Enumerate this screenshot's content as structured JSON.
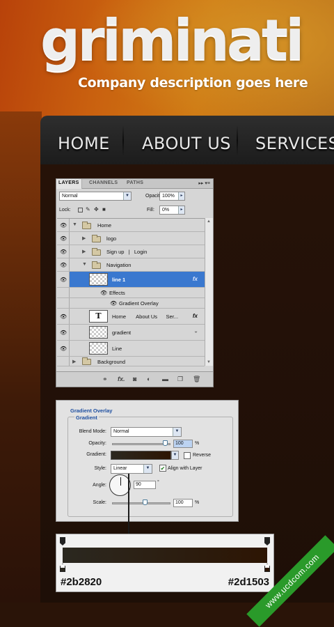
{
  "header": {
    "logo": "griminati",
    "tagline": "Company description goes here"
  },
  "nav": {
    "items": [
      "HOME",
      "ABOUT US",
      "SERVICES"
    ]
  },
  "layers_panel": {
    "tabs": [
      "LAYERS",
      "CHANNELS",
      "PATHS"
    ],
    "blend_mode": "Normal",
    "opacity_label": "Opacity:",
    "opacity_value": "100%",
    "lock_label": "Lock:",
    "fill_label": "Fill:",
    "fill_value": "0%",
    "layers": [
      {
        "name": "Home",
        "type": "folder",
        "expanded": true
      },
      {
        "name": "logo",
        "type": "folder"
      },
      {
        "name": "Sign up   |   Login",
        "type": "folder"
      },
      {
        "name": "Navigation",
        "type": "folder",
        "expanded": true
      },
      {
        "name": "line 1",
        "type": "layer",
        "selected": true,
        "fx": "fx"
      },
      {
        "name": "Effects",
        "type": "effect"
      },
      {
        "name": "Gradient Overlay",
        "type": "effect"
      },
      {
        "name": "Home       About Us      Ser...",
        "type": "text",
        "fx": "fx"
      },
      {
        "name": "gradient",
        "type": "layer"
      },
      {
        "name": "Line",
        "type": "layer"
      },
      {
        "name": "Background",
        "type": "folder"
      }
    ],
    "text_thumb": "T"
  },
  "gradient_overlay": {
    "title": "Gradient Overlay",
    "section": "Gradient",
    "blend_mode_label": "Blend Mode:",
    "blend_mode_value": "Normal",
    "opacity_label": "Opacity:",
    "opacity_value": "100",
    "opacity_unit": "%",
    "gradient_label": "Gradient:",
    "reverse_label": "Reverse",
    "style_label": "Style:",
    "style_value": "Linear",
    "align_label": "Align with Layer",
    "angle_label": "Angle:",
    "angle_value": "90",
    "angle_unit": "°",
    "scale_label": "Scale:",
    "scale_value": "100",
    "scale_unit": "%"
  },
  "gradient_bar": {
    "left_color": "#2b2820",
    "right_color": "#2d1503"
  },
  "watermark": "www.ucdcom.com"
}
